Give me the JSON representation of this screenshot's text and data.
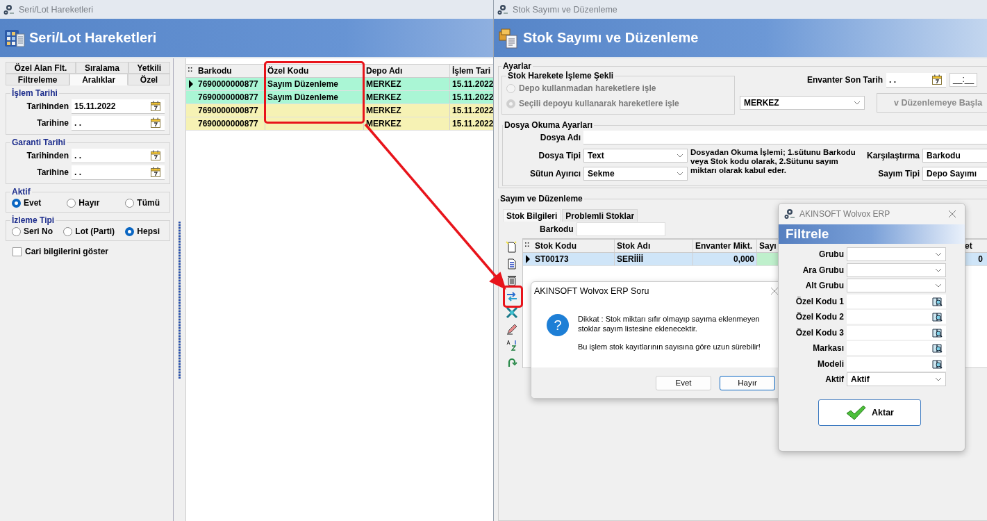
{
  "left_window": {
    "title": "Seri/Lot Hareketleri",
    "heading": "Seri/Lot Hareketleri",
    "tab_rows": [
      [
        {
          "label": "Özel Alan Flt.",
          "selected": false
        },
        {
          "label": "Sıralama",
          "selected": false
        },
        {
          "label": "Yetkili",
          "selected": false
        }
      ],
      [
        {
          "label": "Filtreleme",
          "selected": false
        },
        {
          "label": "Aralıklar",
          "selected": true
        },
        {
          "label": "Özel",
          "selected": false
        }
      ]
    ],
    "date_groups": [
      {
        "legend": "İşlem Tarihi",
        "fields": [
          {
            "label": "Tarihinden",
            "value": "15.11.2022"
          },
          {
            "label": "Tarihine",
            "value": ". ."
          }
        ]
      },
      {
        "legend": "Garanti Tarihi",
        "fields": [
          {
            "label": "Tarihinden",
            "value": ". ."
          },
          {
            "label": "Tarihine",
            "value": ". ."
          }
        ]
      }
    ],
    "radio_groups": [
      {
        "legend": "Aktif",
        "options": [
          {
            "label": "Evet",
            "selected": true
          },
          {
            "label": "Hayır",
            "selected": false
          },
          {
            "label": "Tümü",
            "selected": false
          }
        ]
      },
      {
        "legend": "İzleme Tipi",
        "options": [
          {
            "label": "Seri No",
            "selected": false
          },
          {
            "label": "Lot (Parti)",
            "selected": false
          },
          {
            "label": "Hepsi",
            "selected": true
          }
        ]
      }
    ],
    "checkbox": {
      "label": "Cari bilgilerini göster",
      "checked": false
    },
    "grid": {
      "corner": "::",
      "columns": [
        "Barkodu",
        "Özel Kodu",
        "Depo Adı",
        "İşlem Tari"
      ],
      "rows": [
        {
          "cells": [
            "7690000000877",
            "Sayım Düzenleme",
            "MERKEZ",
            "15.11.2022"
          ],
          "current": true,
          "color": "#aaf6d5"
        },
        {
          "cells": [
            "7690000000877",
            "Sayım Düzenleme",
            "MERKEZ",
            "15.11.2022"
          ],
          "current": false,
          "color": "#aaf6d5"
        },
        {
          "cells": [
            "7690000000877",
            null,
            "MERKEZ",
            "15.11.2022"
          ],
          "current": false,
          "color": "#f6f2b4"
        },
        {
          "cells": [
            "7690000000877",
            null,
            "MERKEZ",
            "15.11.2022"
          ],
          "current": false,
          "color": "#f6f2b4"
        }
      ]
    }
  },
  "right_window": {
    "title": "Stok Sayımı ve Düzenleme",
    "heading": "Stok Sayımı ve Düzenleme",
    "ayarlar": {
      "legend": "Ayarlar",
      "mode_group": {
        "legend": "Stok Harekete İşleme Şekli",
        "options": [
          {
            "label": "Depo kullanmadan hareketlere işle",
            "selected": false,
            "disabled": true
          },
          {
            "label": "Seçili depoyu kullanarak hareketlere işle",
            "selected": true,
            "disabled": true
          }
        ]
      },
      "envanter_label": "Envanter Son Tarih",
      "envanter_date": ". .",
      "envanter_time": "__:__",
      "depot": "MERKEZ",
      "start_button": {
        "label": "v Düzenlemeye Başla",
        "disabled": true
      }
    },
    "dosya": {
      "legend": "Dosya Okuma Ayarları",
      "dosya_adi_label": "Dosya Adı",
      "dosya_tipi": {
        "label": "Dosya Tipi",
        "value": "Text"
      },
      "sutun_ayiraci": {
        "label": "Sütun Ayırıcı",
        "value": "Sekme"
      },
      "note": "Dosyadan Okuma İşlemi; 1.sütunu Barkodu veya Stok kodu olarak, 2.Sütunu sayım miktarı olarak kabul eder.",
      "karsilastirma": {
        "label": "Karşılaştırma",
        "value": "Barkodu"
      },
      "sayim_tipi": {
        "label": "Sayım Tipi",
        "value": "Depo Sayımı"
      }
    },
    "sayim": {
      "legend": "Sayım ve Düzenleme",
      "tabs": [
        {
          "label": "Stok Bilgileri",
          "selected": true
        },
        {
          "label": "Problemli Stoklar",
          "selected": false
        }
      ],
      "barkodu_label": "Barkodu",
      "grid": {
        "corner": "::",
        "columns": [
          "Stok Kodu",
          "Stok Adı",
          "Envanter Mikt.",
          "Sayı",
          "et"
        ],
        "rows": [
          {
            "cells": [
              "ST00173",
              "SERİİİİ",
              "0,000",
              null,
              "0"
            ],
            "current": true
          }
        ]
      }
    }
  },
  "question_dialog": {
    "title": "AKINSOFT Wolvox ERP Soru",
    "icon_glyph": "?",
    "paragraphs": [
      "Dikkat : Stok miktarı sıfır olmayıp sayıma eklenmeyen stoklar sayım listesine eklenecektir.",
      "Bu işlem stok kayıtlarının sayısına göre uzun sürebilir!"
    ],
    "buttons": [
      {
        "label": "Evet",
        "default": false
      },
      {
        "label": "Hayır",
        "default": true
      }
    ]
  },
  "filter_dialog": {
    "title": "AKINSOFT Wolvox ERP",
    "heading": "Filtrele",
    "fields": [
      {
        "label": "Grubu",
        "kind": "combo"
      },
      {
        "label": "Ara Grubu",
        "kind": "combo"
      },
      {
        "label": "Alt Grubu",
        "kind": "combo"
      },
      {
        "label": "Özel Kodu 1",
        "kind": "lookup"
      },
      {
        "label": "Özel Kodu 2",
        "kind": "lookup"
      },
      {
        "label": "Özel Kodu 3",
        "kind": "lookup"
      },
      {
        "label": "Markası",
        "kind": "lookup"
      },
      {
        "label": "Modeli",
        "kind": "lookup"
      },
      {
        "label": "Aktif",
        "kind": "combo",
        "value": "Aktif"
      }
    ],
    "button": "Aktar"
  },
  "annotations": [
    {
      "kind": "box"
    },
    {
      "kind": "arrow"
    },
    {
      "kind": "box"
    }
  ]
}
